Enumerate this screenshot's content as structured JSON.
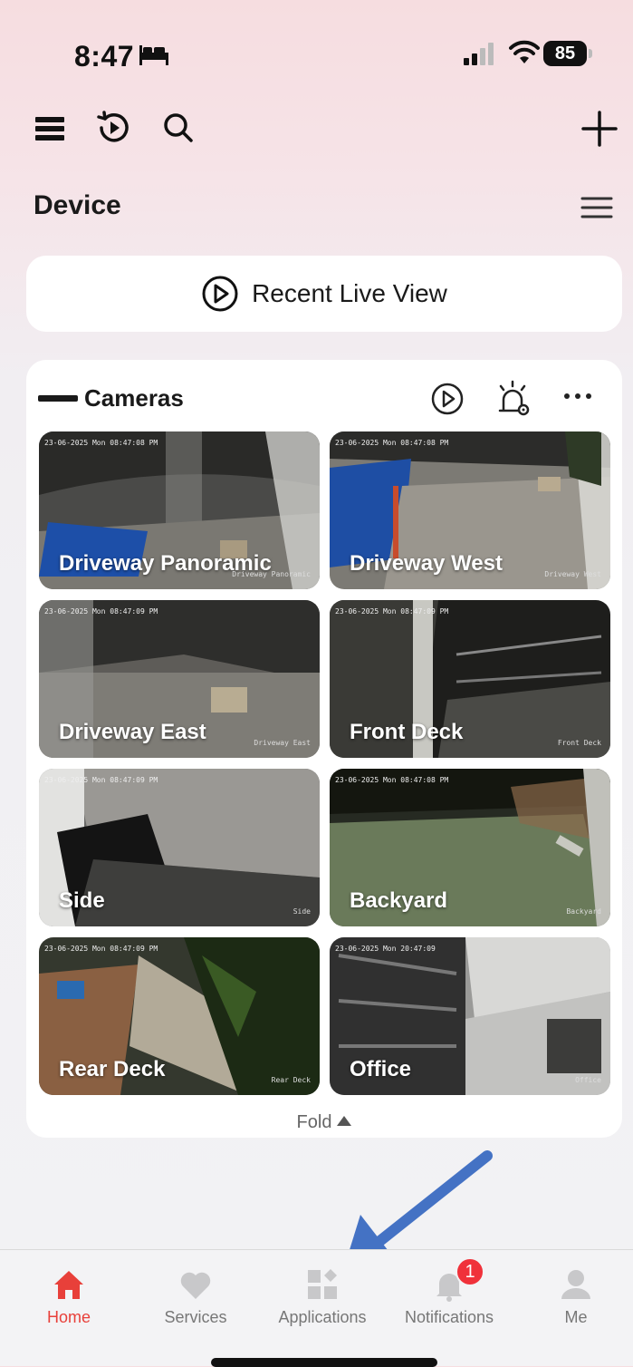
{
  "status_bar": {
    "time": "8:47",
    "battery": "85"
  },
  "toolbar": {
    "menu_icon": "list-icon",
    "replay_icon": "playback-icon",
    "search_icon": "search-icon",
    "add_icon": "plus-icon"
  },
  "section": {
    "title": "Device"
  },
  "recent": {
    "label": "Recent Live View"
  },
  "cameras": {
    "title": "Cameras",
    "fold_label": "Fold",
    "tiles": [
      {
        "name": "Driveway Panoramic",
        "timestamp": "23-06-2025 Mon 08:47:08 PM",
        "watermark": "Driveway Panoramic"
      },
      {
        "name": "Driveway West",
        "timestamp": "23-06-2025 Mon 08:47:08 PM",
        "watermark": "Driveway West"
      },
      {
        "name": "Driveway East",
        "timestamp": "23-06-2025 Mon 08:47:09 PM",
        "watermark": "Driveway East"
      },
      {
        "name": "Front Deck",
        "timestamp": "23-06-2025 Mon 08:47:09 PM",
        "watermark": "Front Deck"
      },
      {
        "name": "Side",
        "timestamp": "23-06-2025 Mon 08:47:09 PM",
        "watermark": "Side"
      },
      {
        "name": "Backyard",
        "timestamp": "23-06-2025 Mon 08:47:08 PM",
        "watermark": "Backyard"
      },
      {
        "name": "Rear Deck",
        "timestamp": "23-06-2025 Mon 08:47:09 PM",
        "watermark": "Rear Deck"
      },
      {
        "name": "Office",
        "timestamp": "23-06-2025 Mon 20:47:09",
        "watermark": "Office"
      }
    ]
  },
  "tabs": {
    "home": "Home",
    "services": "Services",
    "applications": "Applications",
    "notifications": "Notifications",
    "notifications_badge": "1",
    "me": "Me"
  },
  "colors": {
    "accent": "#e8403a",
    "arrow": "#4472c4",
    "badge": "#f0313a"
  }
}
